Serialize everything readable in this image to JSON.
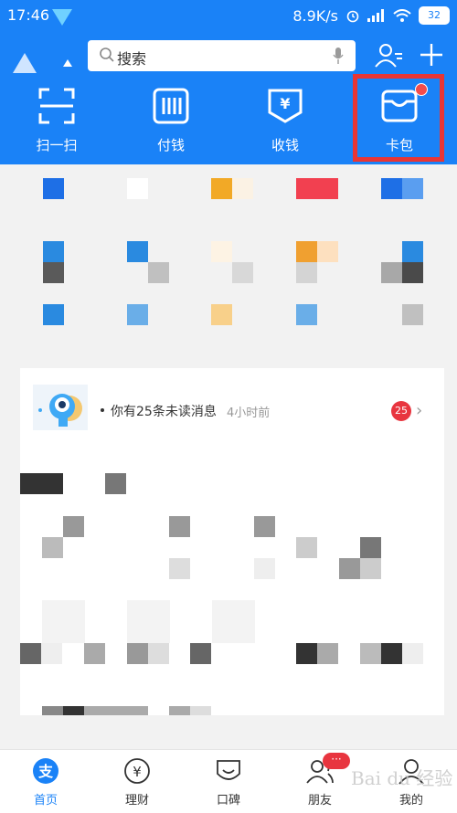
{
  "status_bar": {
    "time": "17:46",
    "speed": "8.9K/s",
    "battery": "32"
  },
  "search": {
    "placeholder": "搜索"
  },
  "quick_actions": [
    {
      "label": "扫一扫",
      "icon": "scan-icon"
    },
    {
      "label": "付钱",
      "icon": "pay-icon"
    },
    {
      "label": "收钱",
      "icon": "receive-money-icon"
    },
    {
      "label": "卡包",
      "icon": "card-wallet-icon"
    }
  ],
  "message": {
    "text": "你有25条未读消息",
    "time": "4小时前",
    "count": "25"
  },
  "tabs": [
    {
      "label": "首页",
      "icon": "home-icon",
      "active": true
    },
    {
      "label": "理财",
      "icon": "finance-icon",
      "active": false
    },
    {
      "label": "口碑",
      "icon": "koubei-icon",
      "active": false
    },
    {
      "label": "朋友",
      "icon": "friends-icon",
      "active": false
    },
    {
      "label": "我的",
      "icon": "profile-icon",
      "active": false
    }
  ],
  "friends_badge": "···",
  "watermark": "Bai du 经验",
  "colors": {
    "brand": "#1a82f7",
    "highlight": "#e83535",
    "badge": "#e8353f"
  }
}
